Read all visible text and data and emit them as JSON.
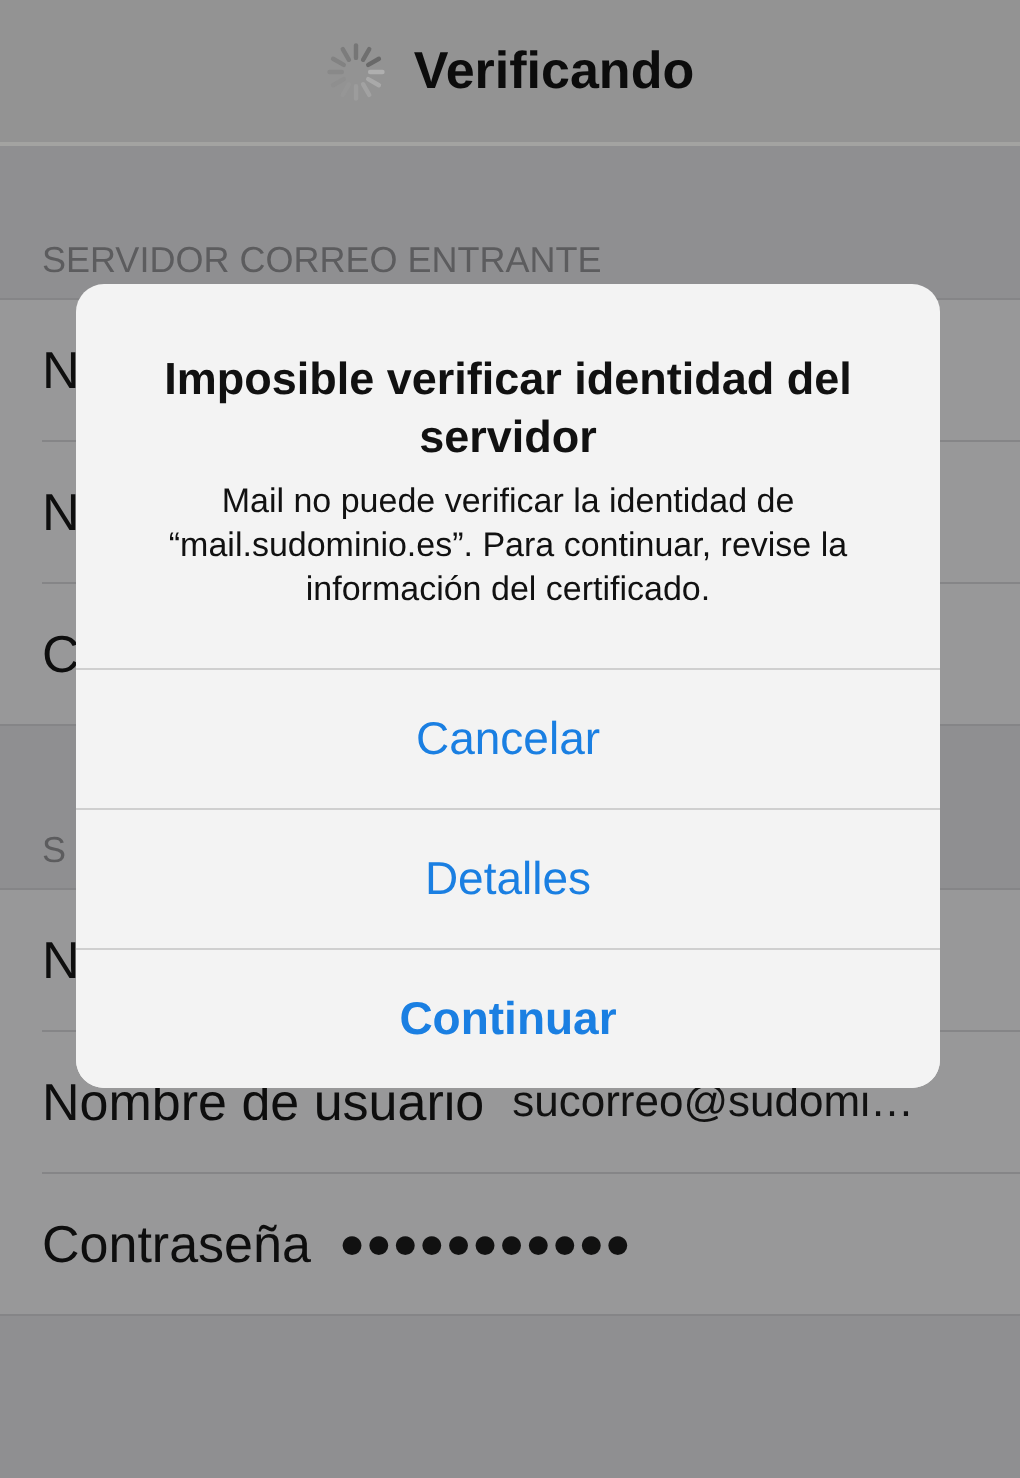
{
  "nav_bar": {
    "title": "Verificando",
    "loading": true
  },
  "sections": [
    {
      "header": "SERVIDOR CORREO ENTRANTE",
      "rows": [
        {
          "label": "N"
        },
        {
          "label": "N"
        },
        {
          "label": "C"
        }
      ]
    },
    {
      "header": "S",
      "rows": [
        {
          "label": "N"
        },
        {
          "label": "Nombre de usuario",
          "value": "sucorreo@sudomi…"
        },
        {
          "label": "Contraseña",
          "value": "●●●●●●●●●●●"
        }
      ]
    }
  ],
  "alert": {
    "title": "Imposible verificar identidad del servidor",
    "message": "Mail no puede verificar la identidad de “mail.sudominio.es”. Para continuar, revise la información del certificado.",
    "buttons": [
      {
        "label": "Cancelar",
        "preferred": false
      },
      {
        "label": "Detalles",
        "preferred": false
      },
      {
        "label": "Continuar",
        "preferred": true
      }
    ]
  }
}
